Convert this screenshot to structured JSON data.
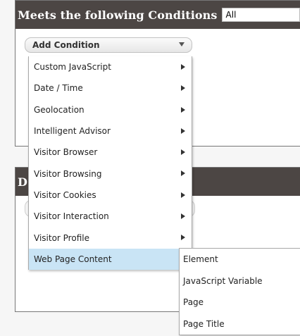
{
  "conditions_panel": {
    "title": "Meets the following Conditions",
    "match_value": "All"
  },
  "add_condition": {
    "label": "Add Condition",
    "arrow_icon": "chevron-down-icon"
  },
  "lower_panel": {
    "title_fragment": "D"
  },
  "menu": {
    "items": [
      {
        "label": "Custom JavaScript",
        "has_submenu": true
      },
      {
        "label": "Date / Time",
        "has_submenu": true
      },
      {
        "label": "Geolocation",
        "has_submenu": true
      },
      {
        "label": "Intelligent Advisor",
        "has_submenu": true
      },
      {
        "label": "Visitor Browser",
        "has_submenu": true
      },
      {
        "label": "Visitor Browsing",
        "has_submenu": true
      },
      {
        "label": "Visitor Cookies",
        "has_submenu": true
      },
      {
        "label": "Visitor Interaction",
        "has_submenu": true
      },
      {
        "label": "Visitor Profile",
        "has_submenu": true
      },
      {
        "label": "Web Page Content",
        "has_submenu": true,
        "highlighted": true
      }
    ]
  },
  "submenu": {
    "items": [
      {
        "label": "Element"
      },
      {
        "label": "JavaScript Variable"
      },
      {
        "label": "Page"
      },
      {
        "label": "Page Title"
      }
    ]
  },
  "colors": {
    "header_bg": "#4c4644",
    "highlight": "#c9e4f5",
    "page_bg": "#f6f6f6"
  }
}
